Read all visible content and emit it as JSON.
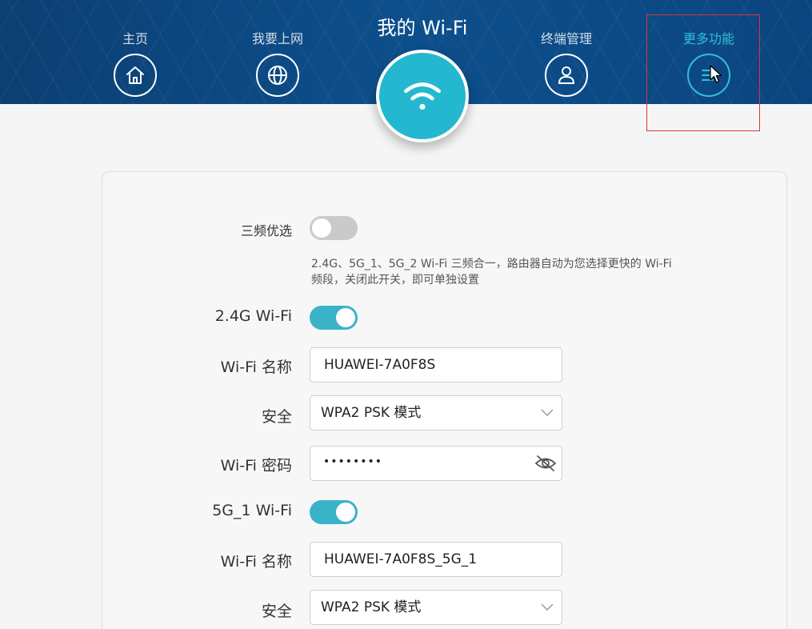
{
  "nav": {
    "home": "主页",
    "internet": "我要上网",
    "wifi_title": "我的 Wi-Fi",
    "devices": "终端管理",
    "more": "更多功能"
  },
  "form": {
    "tri_band_label": "三频优选",
    "tri_band_enabled": false,
    "tri_band_hint": "2.4G、5G_1、5G_2 Wi-Fi 三频合一，路由器自动为您选择更快的 Wi-Fi 频段，关闭此开关，即可单独设置",
    "band24": {
      "label": "2.4G Wi-Fi",
      "enabled": true,
      "name_label": "Wi-Fi 名称",
      "name_value": "HUAWEI-7A0F8S",
      "security_label": "安全",
      "security_value": "WPA2 PSK 模式",
      "password_label": "Wi-Fi 密码",
      "password_value": "••••••••"
    },
    "band5g1": {
      "label": "5G_1 Wi-Fi",
      "enabled": true,
      "name_label": "Wi-Fi 名称",
      "name_value": "HUAWEI-7A0F8S_5G_1",
      "security_label": "安全",
      "security_value": "WPA2 PSK 模式"
    }
  },
  "colors": {
    "header": "#0d4f8c",
    "accent": "#2fc1da",
    "toggle_on": "#3ab3c9",
    "toggle_off": "#cacaca",
    "highlight": "#d0393c"
  },
  "icons": [
    "home-icon",
    "globe-icon",
    "wifi-icon",
    "user-icon",
    "menu-list-icon",
    "chevron-down-icon",
    "eye-hidden-icon",
    "mouse-cursor-icon"
  ]
}
